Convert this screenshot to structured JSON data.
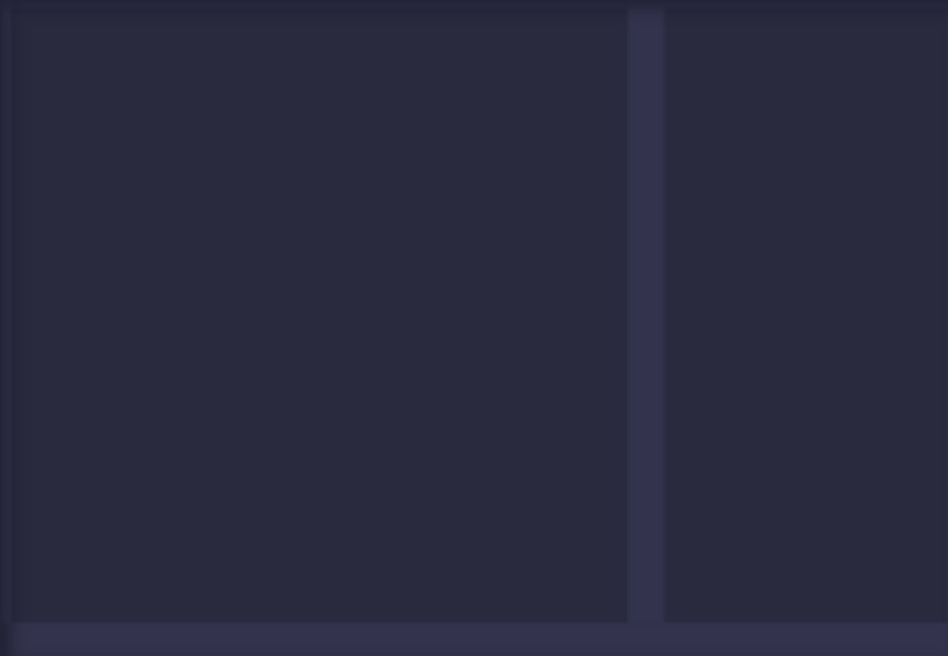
{
  "colors": {
    "background": "#33334d",
    "pane": "#292a3e",
    "edge": "#3a3a57"
  },
  "layout": {
    "panes": [
      "left-pane",
      "right-pane"
    ],
    "has_splitter": true,
    "has_bottom_bar": true
  }
}
